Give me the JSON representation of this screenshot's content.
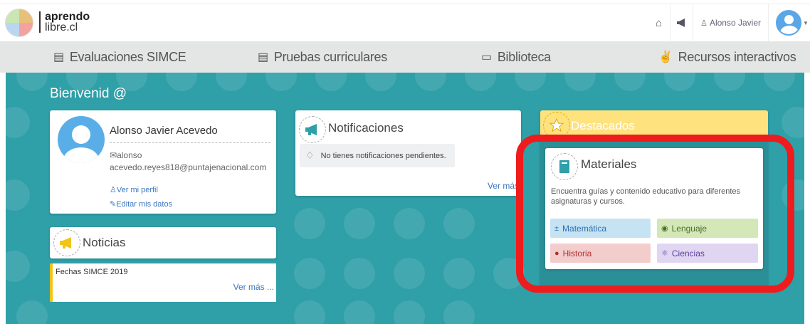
{
  "header": {
    "logo": {
      "line1": "aprendo",
      "line2": "libre.cl"
    },
    "icons": [
      "home-icon",
      "megaphone-icon"
    ],
    "user_name": "Alonso Javier"
  },
  "nav": {
    "items": [
      {
        "label": "Evaluaciones SIMCE",
        "icon": "newspaper-icon"
      },
      {
        "label": "Pruebas curriculares",
        "icon": "newspaper-icon"
      },
      {
        "label": "Biblioteca",
        "icon": "book-open-icon"
      },
      {
        "label": "Recursos interactivos",
        "icon": "hand-peace-icon"
      }
    ]
  },
  "welcome": "Bienvenid @",
  "profile": {
    "name": "Alonso Javier Acevedo",
    "email_line1": "alonso",
    "email_line2": "acevedo.reyes818@puntajenacional.com",
    "link_profile": "Ver mi perfil",
    "link_edit": "Editar mis datos"
  },
  "notifications": {
    "title": "Notificaciones",
    "empty_text": "No tienes notificaciones pendientes.",
    "more": "Ver más"
  },
  "news": {
    "title": "Noticias",
    "item": "Fechas SIMCE 2019",
    "more": "Ver más ..."
  },
  "featured": {
    "title": "Destacados",
    "materials": {
      "title": "Materiales",
      "description": "Encuentra guías y contenido educativo para diferentes asignaturas y cursos.",
      "subjects": [
        {
          "label": "Matemática",
          "icon": "math-icon",
          "bg": "#c5e3f2",
          "color": "#2f6fb0"
        },
        {
          "label": "Lenguaje",
          "icon": "speech-bubble-icon",
          "bg": "#d4e7b8",
          "color": "#4b6b25"
        },
        {
          "label": "Historia",
          "icon": "globe-icon",
          "bg": "#f3cccc",
          "color": "#b13030"
        },
        {
          "label": "Ciencias",
          "icon": "atom-icon",
          "bg": "#e1d6f2",
          "color": "#5a3f9a"
        }
      ]
    }
  },
  "colors": {
    "main_bg": "#2f9fa8",
    "featured_bg": "#fde27e",
    "highlight": "#ee1c1c",
    "link": "#3a78c2"
  }
}
